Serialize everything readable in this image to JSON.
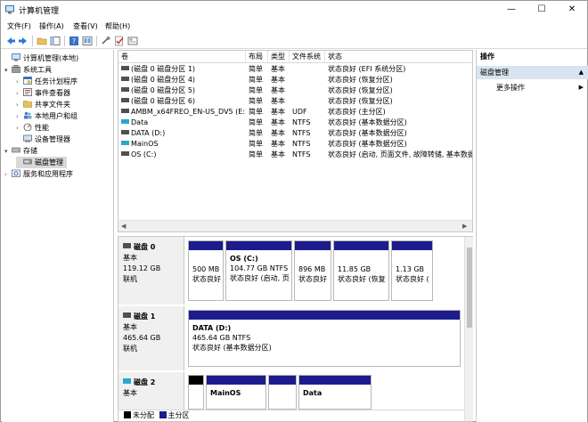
{
  "window": {
    "title": "计算机管理"
  },
  "menu": [
    "文件(F)",
    "操作(A)",
    "查看(V)",
    "帮助(H)"
  ],
  "tree": [
    {
      "label": "计算机管理(本地)",
      "level": 0,
      "expander": ""
    },
    {
      "label": "系统工具",
      "level": 1,
      "expander": "▾"
    },
    {
      "label": "任务计划程序",
      "level": 2,
      "expander": "›"
    },
    {
      "label": "事件查看器",
      "level": 2,
      "expander": "›"
    },
    {
      "label": "共享文件夹",
      "level": 2,
      "expander": "›"
    },
    {
      "label": "本地用户和组",
      "level": 2,
      "expander": "›"
    },
    {
      "label": "性能",
      "level": 2,
      "expander": "›"
    },
    {
      "label": "设备管理器",
      "level": 2,
      "expander": ""
    },
    {
      "label": "存储",
      "level": 1,
      "expander": "▾"
    },
    {
      "label": "磁盘管理",
      "level": 2,
      "expander": "",
      "selected": true
    },
    {
      "label": "服务和应用程序",
      "level": 1,
      "expander": "›"
    }
  ],
  "volumes": {
    "headers": [
      "卷",
      "布局",
      "类型",
      "文件系统",
      "状态"
    ],
    "rows": [
      {
        "name": "(磁盘 0 磁盘分区 1)",
        "layout": "简单",
        "type": "基本",
        "fs": "",
        "status": "状态良好 (EFI 系统分区)",
        "kind": "drive"
      },
      {
        "name": "(磁盘 0 磁盘分区 4)",
        "layout": "简单",
        "type": "基本",
        "fs": "",
        "status": "状态良好 (恢复分区)",
        "kind": "drive"
      },
      {
        "name": "(磁盘 0 磁盘分区 5)",
        "layout": "简单",
        "type": "基本",
        "fs": "",
        "status": "状态良好 (恢复分区)",
        "kind": "drive"
      },
      {
        "name": "(磁盘 0 磁盘分区 6)",
        "layout": "简单",
        "type": "基本",
        "fs": "",
        "status": "状态良好 (恢复分区)",
        "kind": "drive"
      },
      {
        "name": "AMBM_x64FREO_EN-US_DV5 (E:)",
        "layout": "简单",
        "type": "基本",
        "fs": "UDF",
        "status": "状态良好 (主分区)",
        "kind": "drive"
      },
      {
        "name": "Data",
        "layout": "简单",
        "type": "基本",
        "fs": "NTFS",
        "status": "状态良好 (基本数据分区)",
        "kind": "cyan"
      },
      {
        "name": "DATA (D:)",
        "layout": "简单",
        "type": "基本",
        "fs": "NTFS",
        "status": "状态良好 (基本数据分区)",
        "kind": "drive"
      },
      {
        "name": "MainOS",
        "layout": "简单",
        "type": "基本",
        "fs": "NTFS",
        "status": "状态良好 (基本数据分区)",
        "kind": "cyan"
      },
      {
        "name": "OS (C:)",
        "layout": "简单",
        "type": "基本",
        "fs": "NTFS",
        "status": "状态良好 (启动, 页面文件, 故障转储, 基本数据",
        "kind": "drive"
      }
    ]
  },
  "disks": [
    {
      "name": "磁盘 0",
      "type": "基本",
      "size": "119.12 GB",
      "state": "联机",
      "partitions": [
        {
          "name": "",
          "size": "500 MB",
          "status": "状态良好"
        },
        {
          "name": "OS  (C:)",
          "size": "104.77 GB NTFS",
          "status": "状态良好 (启动, 页"
        },
        {
          "name": "",
          "size": "896 MB",
          "status": "状态良好"
        },
        {
          "name": "",
          "size": "11.85 GB",
          "status": "状态良好 (恢复"
        },
        {
          "name": "",
          "size": "1.13 GB",
          "status": "状态良好 ("
        }
      ]
    },
    {
      "name": "磁盘 1",
      "type": "基本",
      "size": "465.64 GB",
      "state": "联机",
      "partitions": [
        {
          "name": "DATA  (D:)",
          "size": "465.64 GB NTFS",
          "status": "状态良好 (基本数据分区)"
        }
      ]
    },
    {
      "name": "磁盘 2",
      "type": "基本",
      "size": "",
      "state": "",
      "partitions": [
        {
          "name": "",
          "size": "",
          "status": ""
        },
        {
          "name": "MainOS",
          "size": "",
          "status": ""
        },
        {
          "name": "",
          "size": "",
          "status": ""
        },
        {
          "name": "Data",
          "size": "",
          "status": ""
        }
      ]
    }
  ],
  "legend": [
    {
      "label": "未分配",
      "color": "#000000"
    },
    {
      "label": "主分区",
      "color": "#1c1c8c"
    }
  ],
  "actions": {
    "title": "操作",
    "section": "磁盘管理",
    "more": "更多操作"
  },
  "colors": {
    "partition_bar": "#1c1c8c",
    "selection": "#d9e4f1",
    "unallocated": "#000000"
  }
}
